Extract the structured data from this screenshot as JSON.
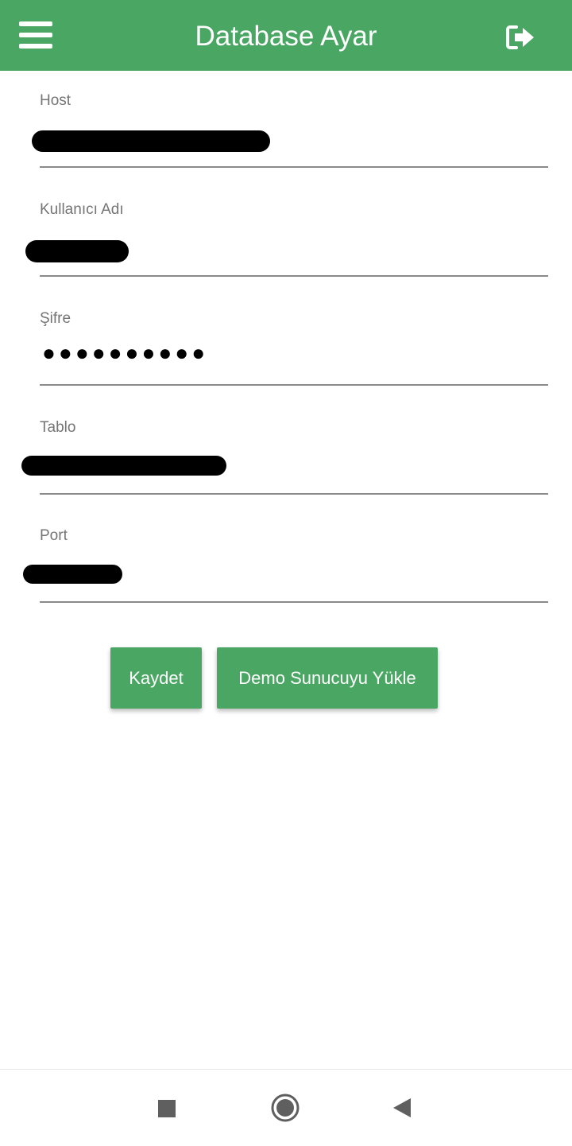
{
  "app_bar": {
    "title": "Database Ayar",
    "menu_icon": "hamburger-menu-icon",
    "logout_icon": "sign-out-icon",
    "color": "#4aa663"
  },
  "form": {
    "fields": [
      {
        "label": "Host",
        "value": "",
        "redacted": true
      },
      {
        "label": "Kullanıcı Adı",
        "value": "",
        "redacted": true
      },
      {
        "label": "Şifre",
        "value": "●●●●●●●●●●",
        "redacted": false
      },
      {
        "label": "Tablo",
        "value": "",
        "redacted": true
      },
      {
        "label": "Port",
        "value": "",
        "redacted": true
      }
    ]
  },
  "buttons": {
    "save": "Kaydet",
    "demo": "Demo Sunucuyu Yükle"
  },
  "nav_bar": {
    "icons": [
      "recents-square-icon",
      "home-circle-icon",
      "back-triangle-icon"
    ]
  }
}
